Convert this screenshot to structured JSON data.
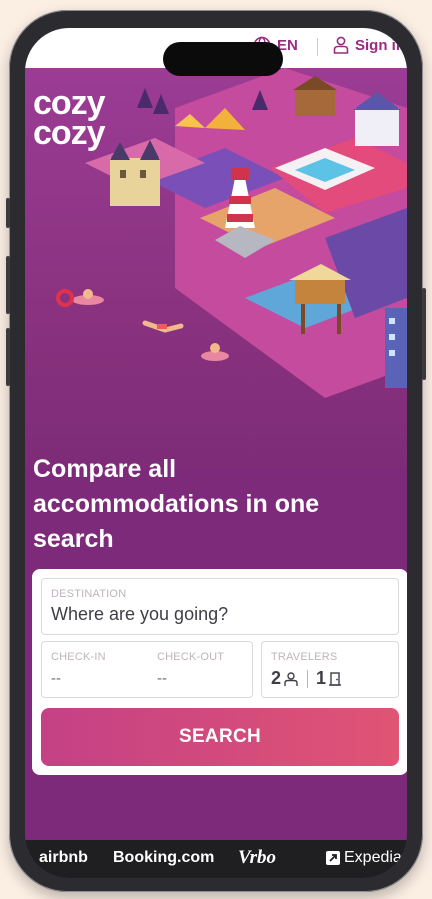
{
  "header": {
    "lang_label": "EN",
    "signin_label": "Sign in"
  },
  "brand": {
    "logo_line1": "cozy",
    "logo_line2": "cozy"
  },
  "hero": {
    "headline": "Compare all accommodations in one search"
  },
  "search": {
    "destination_label": "DESTINATION",
    "destination_placeholder": "Where are you going?",
    "checkin_label": "CHECK-IN",
    "checkin_value": "--",
    "checkout_label": "CHECK-OUT",
    "checkout_value": "--",
    "travelers_label": "TRAVELERS",
    "adults_value": "2",
    "rooms_value": "1",
    "search_button": "SEARCH"
  },
  "partners": {
    "p1": "airbnb",
    "p2": "Booking.com",
    "p3": "Vrbo",
    "p4": "Expedia"
  },
  "colors": {
    "brand_purple": "#8a327f",
    "button_pink": "#d94a7c",
    "link_purple": "#9a2a82"
  }
}
